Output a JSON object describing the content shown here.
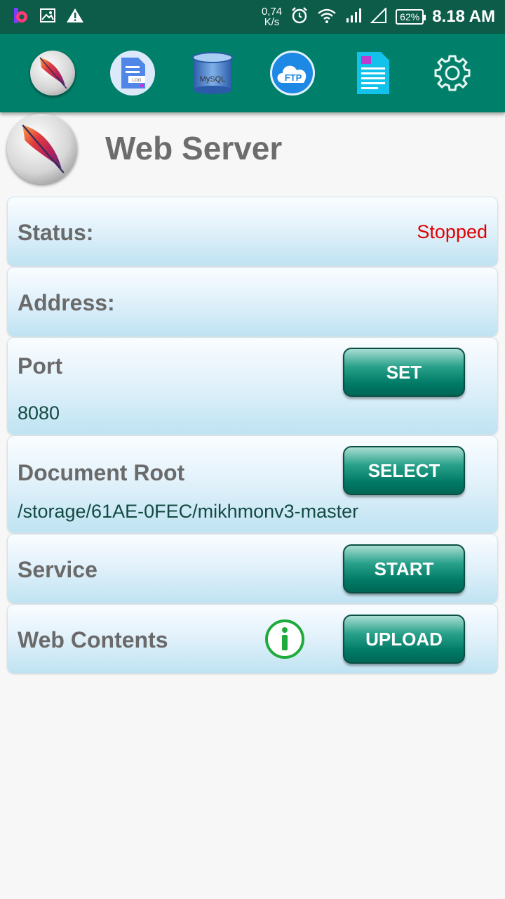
{
  "status_bar": {
    "net_speed_value": "0,74",
    "net_speed_unit": "K/s",
    "battery": "62%",
    "time": "8.18 AM",
    "icons": [
      "app-b-icon",
      "image-icon",
      "warning-icon",
      "alarm-icon",
      "wifi-icon",
      "signal-icon",
      "signal-empty-icon",
      "battery-icon"
    ]
  },
  "toolbar": {
    "items": [
      "apache-icon",
      "log-icon",
      "mysql-icon",
      "ftp-icon",
      "document-icon",
      "settings-icon"
    ],
    "mysql_text": "MySQL",
    "ftp_text": "FTP",
    "log_text": "LOG"
  },
  "header": {
    "title": "Web Server"
  },
  "status": {
    "label": "Status:",
    "value": "Stopped"
  },
  "address": {
    "label": "Address:"
  },
  "port": {
    "label": "Port",
    "value": "8080",
    "button": "SET"
  },
  "docroot": {
    "label": "Document Root",
    "value": "/storage/61AE-0FEC/mikhmonv3-master",
    "button": "SELECT"
  },
  "service": {
    "label": "Service",
    "button": "START"
  },
  "webcontents": {
    "label": "Web Contents",
    "button": "UPLOAD"
  },
  "colors": {
    "status_bar": "#0d5c4a",
    "toolbar": "#00806a",
    "stopped": "#e00000",
    "button": "#007a66",
    "info_green": "#1faa3c"
  }
}
